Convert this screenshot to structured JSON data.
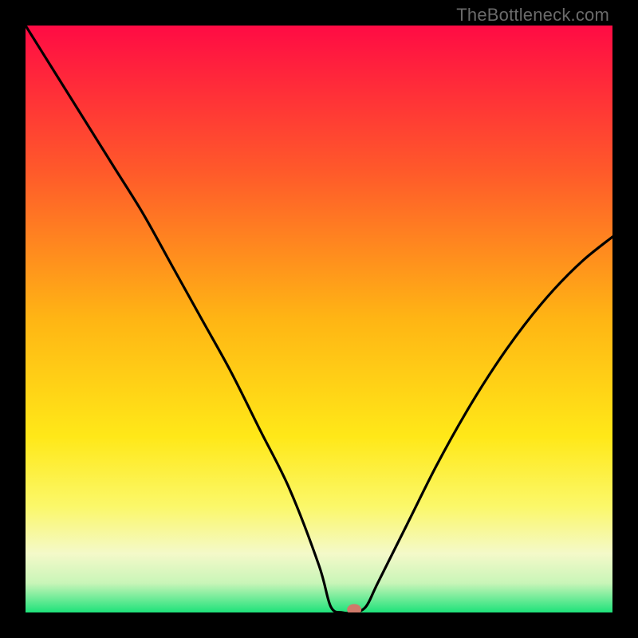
{
  "watermark": "TheBottleneck.com",
  "chart_data": {
    "type": "line",
    "title": "",
    "xlabel": "",
    "ylabel": "",
    "xlim": [
      0,
      100
    ],
    "ylim": [
      0,
      100
    ],
    "grid": false,
    "series": [
      {
        "name": "curve",
        "x": [
          0,
          5,
          10,
          15,
          20,
          25,
          30,
          35,
          40,
          45,
          50,
          52,
          54,
          56,
          58,
          60,
          65,
          70,
          75,
          80,
          85,
          90,
          95,
          100
        ],
        "y": [
          100,
          92,
          84,
          76,
          68,
          59,
          50,
          41,
          31,
          21,
          8,
          1,
          0,
          0,
          1,
          5,
          15,
          25,
          34,
          42,
          49,
          55,
          60,
          64
        ]
      }
    ],
    "marker": {
      "x": 56,
      "y": 0.5,
      "color": "#cf7a6a"
    },
    "gradient_stops": [
      {
        "offset": 0.0,
        "color": "#ff0b44"
      },
      {
        "offset": 0.25,
        "color": "#ff5a2a"
      },
      {
        "offset": 0.5,
        "color": "#ffb514"
      },
      {
        "offset": 0.7,
        "color": "#ffe818"
      },
      {
        "offset": 0.82,
        "color": "#fbf86a"
      },
      {
        "offset": 0.9,
        "color": "#f4f9c9"
      },
      {
        "offset": 0.95,
        "color": "#c9f5b8"
      },
      {
        "offset": 1.0,
        "color": "#1ee27a"
      }
    ]
  }
}
